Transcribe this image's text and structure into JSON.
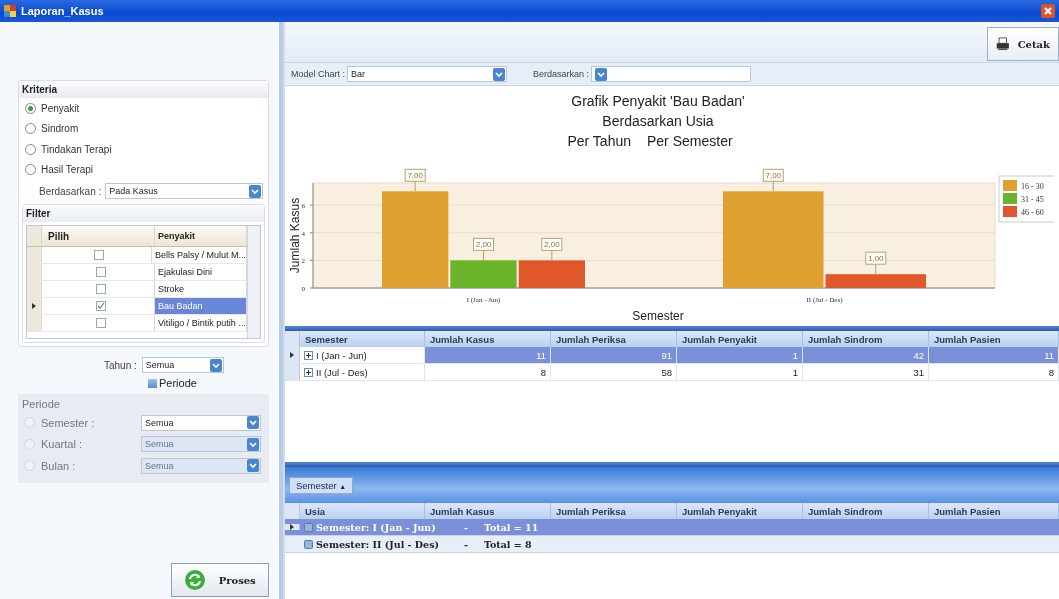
{
  "window": {
    "title": "Laporan_Kasus"
  },
  "kriteria": {
    "title": "Kriteria",
    "options": [
      {
        "label": "Penyakit",
        "selected": true
      },
      {
        "label": "Sindrom",
        "selected": false
      },
      {
        "label": "Tindakan Terapi",
        "selected": false
      },
      {
        "label": "Hasil Terapi",
        "selected": false
      }
    ],
    "berdasarkan": {
      "label": "Berdasarkan :",
      "value": "Pada Kasus"
    }
  },
  "filter": {
    "title": "Filter",
    "columns": [
      "Pilih",
      "Penyakit"
    ],
    "rows": [
      {
        "checked": false,
        "name": "Bells Palsy / Mulut M...",
        "selected": false
      },
      {
        "checked": false,
        "name": "Ejakulasi Dini",
        "selected": false
      },
      {
        "checked": false,
        "name": "Stroke",
        "selected": false
      },
      {
        "checked": true,
        "name": "Bau Badan",
        "selected": true
      },
      {
        "checked": false,
        "name": "Vitiligo / Bintik putih ...",
        "selected": false
      }
    ]
  },
  "tahun": {
    "label": "Tahun :",
    "value": "Semua"
  },
  "periode_toggle": {
    "label": "Periode",
    "checked": false
  },
  "periode": {
    "title": "Periode",
    "disabled": true,
    "options": [
      {
        "label": "Semester :",
        "value": "Semua",
        "selected": false,
        "disabled": false
      },
      {
        "label": "Kuartal :",
        "value": "Semua",
        "selected": false,
        "disabled": true
      },
      {
        "label": "Bulan :",
        "value": "Semua",
        "selected": false,
        "disabled": true
      }
    ]
  },
  "proses_button": "Proses",
  "cetak_button": "Cetak",
  "model_chart": {
    "label": "Model Chart :",
    "value": "Bar"
  },
  "chart_berdasarkan": {
    "label": "Berdasarkan :"
  },
  "chart": {
    "subtitle": "Berdasarkan Usia",
    "period_labels": [
      "Per Tahun",
      "Per Semester"
    ],
    "chart_data": {
      "type": "bar",
      "title": "Grafik Penyakit 'Bau Badan'",
      "xlabel": "Semester",
      "ylabel": "Jumlah Kasus",
      "categories": [
        "I (Jan - Jun)",
        "II (Jul - Des)"
      ],
      "series": [
        {
          "name": "16 - 30",
          "color": "#e0a030",
          "values": [
            7,
            7
          ],
          "value_labels": [
            "7,00",
            "7,00"
          ]
        },
        {
          "name": "31 - 45",
          "color": "#6ab42a",
          "values": [
            2,
            null
          ],
          "value_labels": [
            "2,00",
            null
          ]
        },
        {
          "name": "46 - 60",
          "color": "#e0582a",
          "values": [
            2,
            1
          ],
          "value_labels": [
            "2,00",
            "1,00"
          ]
        }
      ],
      "ylim": [
        0,
        7.6
      ],
      "yticks": [
        0,
        2,
        4,
        6
      ],
      "grid": true,
      "legend": true
    }
  },
  "grid": {
    "columns": [
      "Semester",
      "Jumlah Kasus",
      "Jumlah Periksa",
      "Jumlah Penyakit",
      "Jumlah Sindrom",
      "Jumlah Pasien"
    ],
    "rows": [
      {
        "selected": true,
        "expanded": false,
        "cells": [
          "I (Jan - Jun)",
          "11",
          "91",
          "1",
          "42",
          "11"
        ]
      },
      {
        "selected": false,
        "expanded": false,
        "cells": [
          "II (Jul - Des)",
          "8",
          "58",
          "1",
          "31",
          "8"
        ]
      }
    ]
  },
  "group_panel": {
    "group_by": "Semester",
    "sort_icon": "▲"
  },
  "group_grid": {
    "columns": [
      "Usia",
      "Jumlah Kasus",
      "Jumlah Periksa",
      "Jumlah Penyakit",
      "Jumlah Sindrom",
      "Jumlah Pasien"
    ],
    "rows": [
      {
        "selected": true,
        "label": "Semester: I (Jan - Jun)",
        "separator": "-",
        "total": "Total = 11"
      },
      {
        "selected": false,
        "label": "Semester: II (Jul - Des)",
        "separator": "-",
        "total": "Total = 8"
      }
    ]
  }
}
